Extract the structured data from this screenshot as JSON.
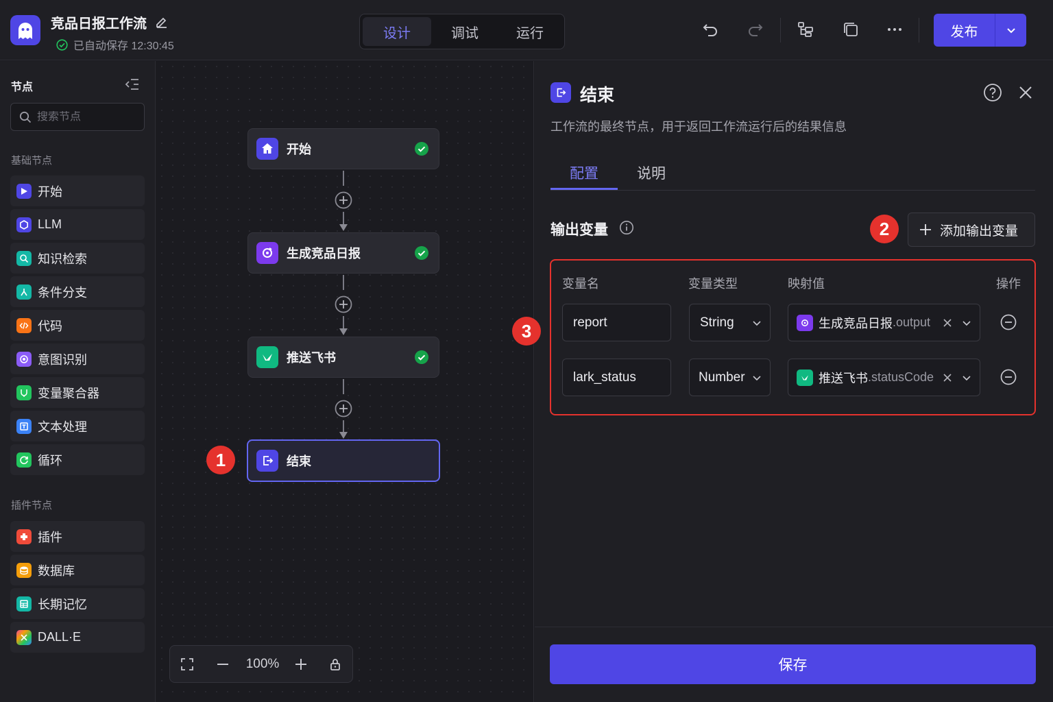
{
  "header": {
    "workflow_title": "竞品日报工作流",
    "autosave_text": "已自动保存 12:30:45",
    "mode_tabs": [
      {
        "label": "设计",
        "active": true
      },
      {
        "label": "调试",
        "active": false
      },
      {
        "label": "运行",
        "active": false
      }
    ],
    "toolbar_icons": [
      "undo-icon",
      "redo-icon",
      "layout-icon",
      "copy-icon",
      "more-icon"
    ],
    "publish_label": "发布",
    "accent_color": "#4f46e5"
  },
  "sidebar": {
    "title": "节点",
    "search_placeholder": "搜索节点",
    "basic_section": "基础节点",
    "basic_items": [
      {
        "label": "开始",
        "icon": "play-icon",
        "color": "#4f46e5"
      },
      {
        "label": "LLM",
        "icon": "llm-icon",
        "color": "#4f46e5"
      },
      {
        "label": "知识检索",
        "icon": "knowledge-search-icon",
        "color": "#14b8a6"
      },
      {
        "label": "条件分支",
        "icon": "branch-icon",
        "color": "#14b8a6"
      },
      {
        "label": "代码",
        "icon": "code-icon",
        "color": "#f97316"
      },
      {
        "label": "意图识别",
        "icon": "intent-icon",
        "color": "#8b5cf6"
      },
      {
        "label": "变量聚合器",
        "icon": "aggregator-icon",
        "color": "#22c55e"
      },
      {
        "label": "文本处理",
        "icon": "text-process-icon",
        "color": "#3b82f6"
      },
      {
        "label": "循环",
        "icon": "loop-icon",
        "color": "#22c55e"
      }
    ],
    "plugin_section": "插件节点",
    "plugin_items": [
      {
        "label": "插件",
        "icon": "plugin-icon",
        "color": "#f04b3a"
      },
      {
        "label": "数据库",
        "icon": "database-icon",
        "color": "#f59e0b"
      },
      {
        "label": "长期记忆",
        "icon": "memory-icon",
        "color": "#14b8a6"
      },
      {
        "label": "DALL·E",
        "icon": "dalle-icon",
        "color": "#ec4899"
      }
    ]
  },
  "canvas": {
    "nodes": [
      {
        "label": "开始",
        "icon": "home-icon",
        "status": "success"
      },
      {
        "label": "生成竞品日报",
        "icon": "llm-icon",
        "status": "success"
      },
      {
        "label": "推送飞书",
        "icon": "lark-icon",
        "status": "success"
      },
      {
        "label": "结束",
        "icon": "end-icon",
        "status": "selected"
      }
    ],
    "zoom": "100%",
    "badges": {
      "end_node": "1",
      "add_var": "2",
      "vars_table": "3"
    }
  },
  "panel": {
    "title": "结束",
    "description": "工作流的最终节点，用于返回工作流运行后的结果信息",
    "tabs": [
      {
        "label": "配置",
        "active": true
      },
      {
        "label": "说明",
        "active": false
      }
    ],
    "section_title": "输出变量",
    "add_variable_label": "添加输出变量",
    "columns": [
      "变量名",
      "变量类型",
      "映射值",
      "操作"
    ],
    "variables": [
      {
        "name": "report",
        "type": "String",
        "map_node": "生成竞品日报",
        "map_field": ".output",
        "map_icon": "llm-icon"
      },
      {
        "name": "lark_status",
        "type": "Number",
        "map_node": "推送飞书",
        "map_field": ".statusCode",
        "map_icon": "lark-icon"
      }
    ],
    "save_label": "保存"
  }
}
